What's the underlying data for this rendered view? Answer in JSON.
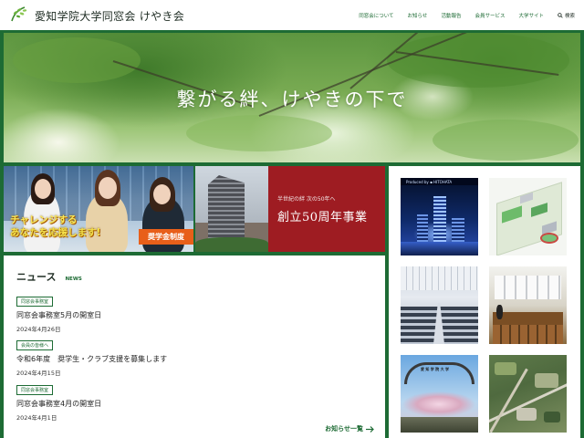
{
  "header": {
    "site_title": "愛知学院大学同窓会 けやき会",
    "nav": [
      {
        "label": "同窓会について"
      },
      {
        "label": "お知らせ"
      },
      {
        "label": "活動報告"
      },
      {
        "label": "会員サービス"
      },
      {
        "label": "大学サイト"
      }
    ],
    "search_label": "検索"
  },
  "hero": {
    "catchphrase": "繋がる絆、けやきの下で"
  },
  "banners": {
    "scholarship": {
      "line1": "チャレンジする",
      "line2": "あなたを応援します!",
      "badge": "奨学金制度"
    },
    "anniversary": {
      "subtitle": "半世紀の絆 次の50年へ",
      "title": "創立50周年事業"
    }
  },
  "news": {
    "title": "ニュース",
    "subtitle": "NEWS",
    "items": [
      {
        "tag": "同窓会事務室",
        "title": "同窓会事務室5月の開室日",
        "date": "2024年4月26日"
      },
      {
        "tag": "会員の皆様へ",
        "title": "令和6年度　奨学生・クラブ支援を募集します",
        "date": "2024年4月15日"
      },
      {
        "tag": "同窓会事務室",
        "title": "同窓会事務室4月の開室日",
        "date": "2024年4月1日"
      }
    ],
    "more_label": "お知らせ一覧"
  },
  "gallery": {
    "t1_brand": "Produced by ▪ HITOHATA",
    "t5_gate_text": "愛 知 学 院 大 学"
  },
  "colors": {
    "brand_green": "#1d6b34",
    "banner_red": "#9e1c22",
    "badge_orange": "#e85f1a"
  }
}
